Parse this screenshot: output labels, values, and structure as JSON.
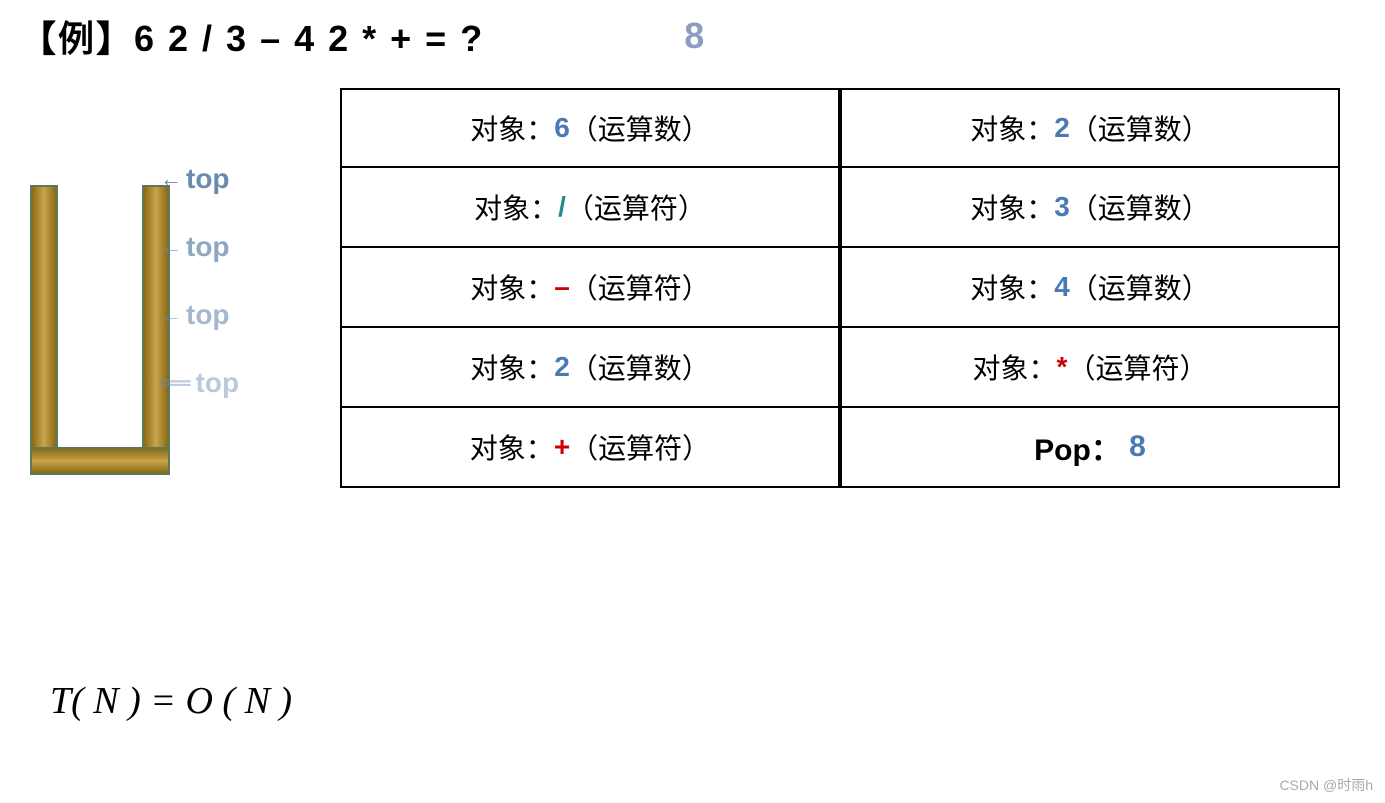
{
  "title": {
    "text": "【例】6 2 / 3 – 4 2 * + = ?",
    "answer": "8"
  },
  "stack": {
    "top_labels": [
      {
        "text": "top",
        "arrows": "←",
        "level": 1
      },
      {
        "text": "top",
        "arrows": "←",
        "level": 2
      },
      {
        "text": "top",
        "arrows": "←",
        "level": 3
      },
      {
        "text": "top",
        "arrows": "⟸",
        "level": 4
      }
    ]
  },
  "table": {
    "rows": [
      {
        "left_label": "对象：",
        "left_value": "6",
        "left_type": "（运算数）",
        "left_color": "blue",
        "right_label": "对象：",
        "right_value": "2",
        "right_type": "（运算数）",
        "right_color": "blue"
      },
      {
        "left_label": "对象：",
        "left_value": "/",
        "left_type": "（运算符）",
        "left_color": "teal",
        "right_label": "对象：",
        "right_value": "3",
        "right_type": "（运算数）",
        "right_color": "blue"
      },
      {
        "left_label": "对象：",
        "left_value": "–",
        "left_type": "（运算符）",
        "left_color": "red",
        "right_label": "对象：",
        "right_value": "4",
        "right_type": "（运算数）",
        "right_color": "blue"
      },
      {
        "left_label": "对象：",
        "left_value": "2",
        "left_type": "（运算数）",
        "left_color": "blue",
        "right_label": "对象：",
        "right_value": "*",
        "right_type": "（运算符）",
        "right_color": "red"
      },
      {
        "left_label": "对象：",
        "left_value": "+",
        "left_type": "（运算符）",
        "left_color": "red",
        "right_label": "Pop：",
        "right_value": "8",
        "right_type": "",
        "right_color": "blue",
        "right_bold": true
      }
    ]
  },
  "formula": {
    "text": "T( N ) = O ( N )"
  },
  "watermark": {
    "text": "CSDN @时雨h"
  }
}
